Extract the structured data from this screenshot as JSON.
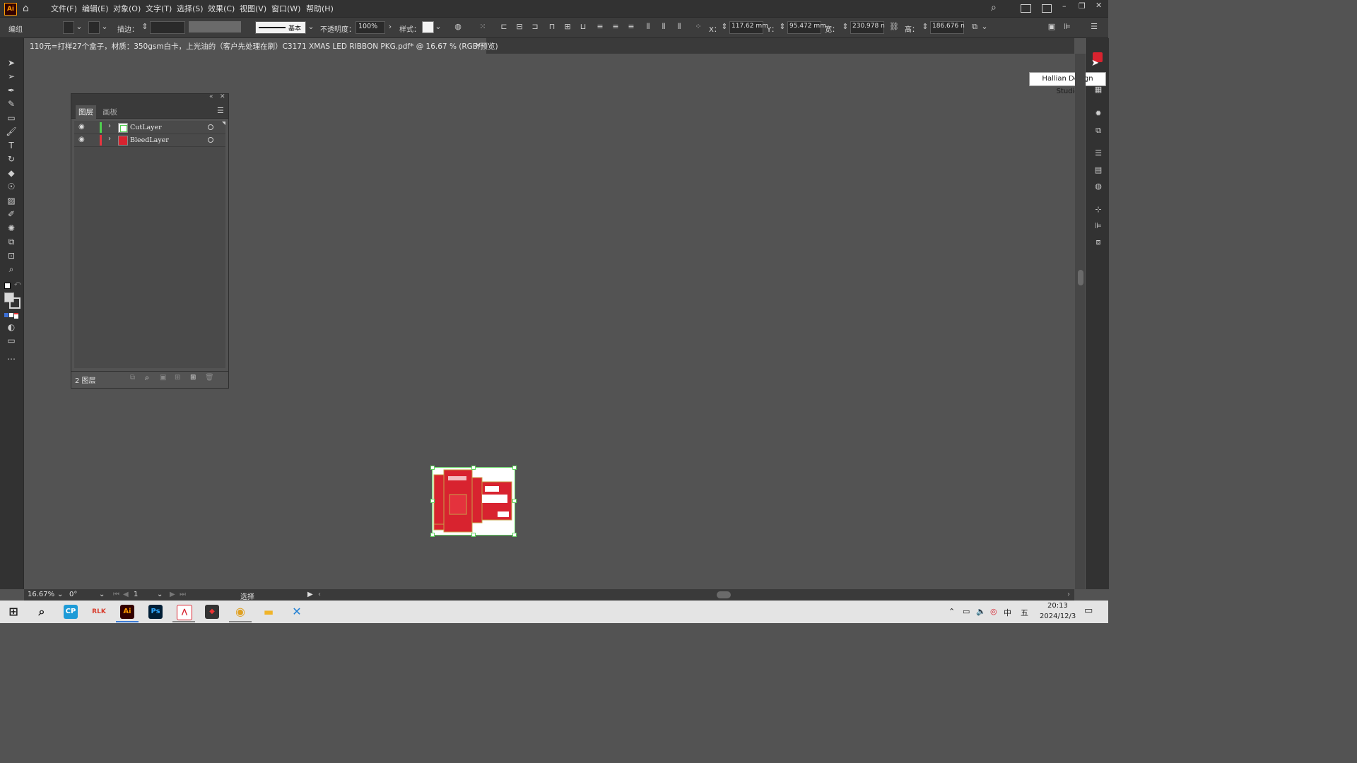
{
  "app": {
    "logo": "Ai",
    "menu": [
      "文件(F)",
      "编辑(E)",
      "对象(O)",
      "文字(T)",
      "选择(S)",
      "效果(C)",
      "视图(V)",
      "窗口(W)",
      "帮助(H)"
    ]
  },
  "control_bar": {
    "selection_label": "编组",
    "stroke_label": "描边：",
    "stroke_style": "基本",
    "opacity_label": "不透明度：",
    "opacity_value": "100%",
    "style_label": "样式：",
    "x_label": "X：",
    "x_value": "117.62 mm",
    "y_label": "Y：",
    "y_value": "95.472 mm",
    "w_label": "宽：",
    "w_value": "230.978 n",
    "h_label": "高：",
    "h_value": "186.676 n"
  },
  "document": {
    "tab_title": "110元=打样27个盒子，材质：350gsm白卡，上光油的（客户先处理在刷）C3171 XMAS LED RIBBON PKG.pdf* @ 16.67 % (RGB/预览)",
    "close": "×"
  },
  "layers_panel": {
    "tabs": [
      "图层",
      "画板"
    ],
    "layers": [
      {
        "name": "CutLayer",
        "color": "#4fd04f"
      },
      {
        "name": "BleedLayer",
        "color": "#e8353f"
      }
    ],
    "count_label": "2 图层"
  },
  "tooltip": "Hallian Design Studio",
  "status_bar": {
    "zoom": "16.67%",
    "rotation": "0°",
    "artboard": "1",
    "tool": "选择"
  },
  "taskbar": {
    "time": "20:13",
    "date": "2024/12/3",
    "ime_lang": "中",
    "ime_mode": "五"
  },
  "colors": {
    "accent": "#ff9a00",
    "box_red": "#d8232f",
    "selection": "#5fd35f"
  }
}
